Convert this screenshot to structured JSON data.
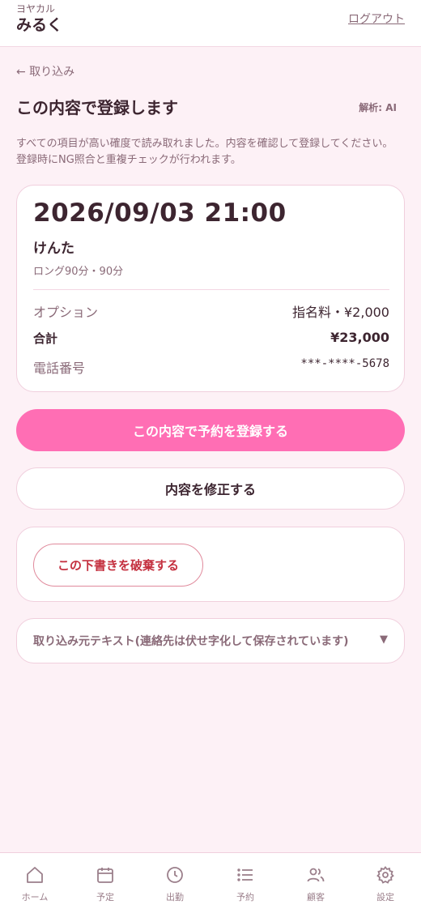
{
  "header": {
    "app_sub": "ヨヤカル",
    "app_name": "みるく",
    "logout": "ログアウト"
  },
  "nav": {
    "back": "← 取り込み"
  },
  "page": {
    "title": "この内容で登録します",
    "analysis": "解析: AI",
    "description": "すべての項目が高い確度で読み取れました。内容を確認して登録してください。 登録時にNG照合と重複チェックが行われます。"
  },
  "booking": {
    "datetime": "2026/09/03 21:00",
    "cast": "けんた",
    "course": "ロング90分・90分",
    "option_label": "オプション",
    "option_value": "指名料・¥2,000",
    "total_label": "合計",
    "total_value": "¥23,000",
    "phone_label": "電話番号",
    "phone_value": "***-****-5678"
  },
  "actions": {
    "register": "この内容で予約を登録する",
    "edit": "内容を修正する",
    "discard": "この下書きを破棄する"
  },
  "source": {
    "label": "取り込み元テキスト(連絡先は伏せ字化して保存されています)",
    "toggle": "▼"
  },
  "tabs": [
    {
      "label": "ホーム",
      "icon": "home-icon"
    },
    {
      "label": "予定",
      "icon": "calendar-icon"
    },
    {
      "label": "出勤",
      "icon": "clock-icon"
    },
    {
      "label": "予約",
      "icon": "list-icon"
    },
    {
      "label": "顧客",
      "icon": "users-icon"
    },
    {
      "label": "設定",
      "icon": "gear-icon"
    }
  ],
  "colors": {
    "accent": "#ff6eb4",
    "background": "#fdf1f6",
    "danger": "#c4303f"
  }
}
